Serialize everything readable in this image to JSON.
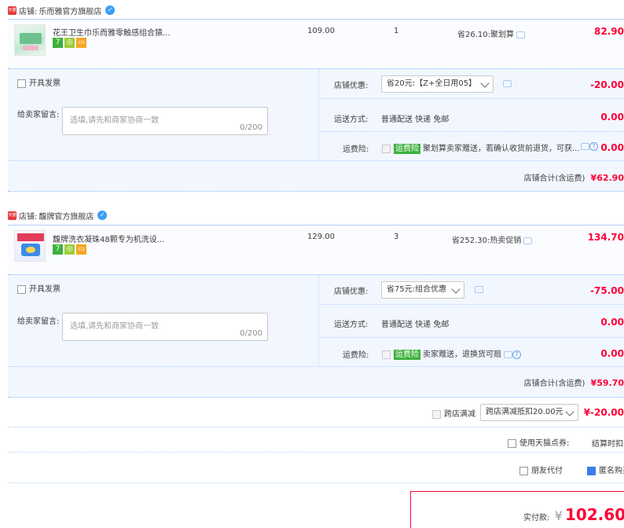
{
  "stores": [
    {
      "store_label": "店铺:",
      "store_name": "乐而雅官方旗舰店",
      "item": {
        "title": "花王卫生巾乐而雅零触感组合猿...",
        "unit_price": "109.00",
        "quantity": "1",
        "promo": "省26.10:聚划算",
        "total": "82.90"
      },
      "invoice_label": "开具发票",
      "message_label": "给卖家留言:",
      "message_placeholder": "选填,请先和商家协商一致",
      "message_count": "0/200",
      "discount_label": "店铺优惠:",
      "discount_option": "省20元:【Z+全日用05】",
      "discount_amount": "-20.00",
      "shipping_label": "运送方式:",
      "shipping_value": "普通配送 快递 免邮",
      "shipping_amount": "0.00",
      "insurance_label": "运费险:",
      "insurance_tag": "运费险",
      "insurance_text": "聚划算卖家赠送，若确认收货前退货，可获...",
      "insurance_amount": "0.00",
      "subtotal_label": "店铺合计(含运费)",
      "subtotal_value": "¥62.90"
    },
    {
      "store_label": "店铺:",
      "store_name": "馥牌官方旗舰店",
      "item": {
        "title": "馥牌洗衣凝珠48颗专为机洗设...",
        "unit_price": "129.00",
        "quantity": "3",
        "promo": "省252.30:热卖促销",
        "total": "134.70"
      },
      "invoice_label": "开具发票",
      "message_label": "给卖家留言:",
      "message_placeholder": "选填,请先和商家协商一致",
      "message_count": "0/200",
      "discount_label": "店铺优惠:",
      "discount_option": "省75元:组合优惠",
      "discount_amount": "-75.00",
      "shipping_label": "运送方式:",
      "shipping_value": "普通配送 快递 免邮",
      "shipping_amount": "0.00",
      "insurance_label": "运费险:",
      "insurance_tag": "运费险",
      "insurance_text": "卖家赠送，退换货可赔",
      "insurance_amount": "0.00",
      "subtotal_label": "店铺合计(含运费)",
      "subtotal_value": "¥59.70"
    }
  ],
  "cross_store": {
    "label": "跨店满减",
    "option": "跨店满减抵扣20.00元",
    "amount": "¥-20.00"
  },
  "tmall_points": {
    "label": "使用天猫点券:",
    "note": "结算时扣"
  },
  "friend_pay": {
    "label": "朋友代付"
  },
  "anonymous": {
    "label": "匿名购买"
  },
  "payment": {
    "label": "实付款:",
    "currency": "¥",
    "amount": "102.60"
  },
  "colors": {
    "accent_red": "#ff0036",
    "border_blue": "#b2d1ff",
    "option_bg": "#f2f7ff"
  }
}
